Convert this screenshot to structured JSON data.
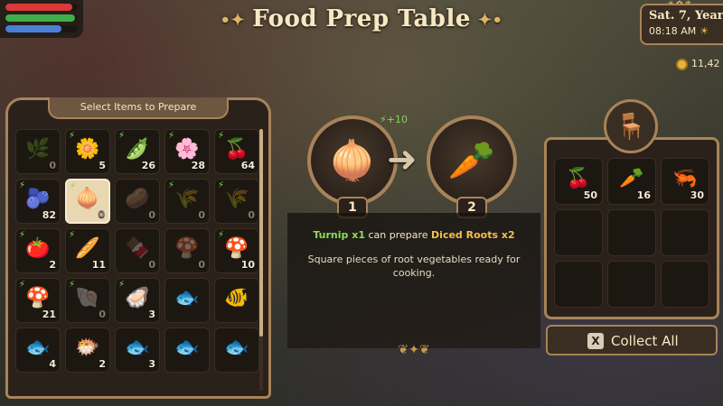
{
  "stats": {
    "health": 0.92,
    "stamina": 0.96,
    "mana": 0.78,
    "colors": {
      "health": "#d83a3a",
      "stamina": "#3fae4a",
      "mana": "#4a7fd6"
    }
  },
  "header": {
    "title": "Food Prep Table"
  },
  "datetime": {
    "date": "Sat. 7, Year",
    "time": "08:18 AM"
  },
  "currency": {
    "amount": "11,42"
  },
  "left_panel": {
    "title": "Select Items to Prepare",
    "items": [
      {
        "icon": "🌿",
        "count": "0",
        "bolt": false,
        "dim": true
      },
      {
        "icon": "🌼",
        "count": "5",
        "bolt": true
      },
      {
        "icon": "🫛",
        "count": "26",
        "bolt": true
      },
      {
        "icon": "🌸",
        "count": "28",
        "bolt": true
      },
      {
        "icon": "🍒",
        "count": "64",
        "bolt": true
      },
      {
        "icon": "🫐",
        "count": "82",
        "bolt": true
      },
      {
        "icon": "🧅",
        "count": "0",
        "bolt": true,
        "selected": true
      },
      {
        "icon": "🥔",
        "count": "0",
        "bolt": false,
        "dim": true
      },
      {
        "icon": "🌾",
        "count": "0",
        "bolt": true,
        "dim": true
      },
      {
        "icon": "🌾",
        "count": "0",
        "bolt": true,
        "dim": true
      },
      {
        "icon": "🍅",
        "count": "2",
        "bolt": true
      },
      {
        "icon": "🥖",
        "count": "11",
        "bolt": true
      },
      {
        "icon": "🍫",
        "count": "0",
        "bolt": false,
        "dim": true
      },
      {
        "icon": "🍄",
        "count": "0",
        "bolt": false,
        "dim": true
      },
      {
        "icon": "🍄",
        "count": "10",
        "bolt": true
      },
      {
        "icon": "🍄",
        "count": "21",
        "bolt": true
      },
      {
        "icon": "🐚",
        "count": "0",
        "bolt": true,
        "dim": true
      },
      {
        "icon": "🦪",
        "count": "3",
        "bolt": true
      },
      {
        "icon": "🐟",
        "count": "",
        "bolt": false
      },
      {
        "icon": "🐠",
        "count": "",
        "bolt": false
      },
      {
        "icon": "🐟",
        "count": "4",
        "bolt": false
      },
      {
        "icon": "🐡",
        "count": "2",
        "bolt": false
      },
      {
        "icon": "🐟",
        "count": "3",
        "bolt": false
      },
      {
        "icon": "🐟",
        "count": "",
        "bolt": false
      },
      {
        "icon": "🐟",
        "count": "",
        "bolt": false
      }
    ]
  },
  "recipe": {
    "input_icon": "🧅",
    "output_icon": "🥕",
    "energy_bonus": "+10",
    "input_number": "1",
    "output_number": "2",
    "ingredient": "Turnip x1",
    "middle": " can prepare ",
    "result": "Diced Roots x2",
    "description": "Square pieces of root vegetables ready for cooking."
  },
  "right_panel": {
    "table_icon": "🪑",
    "outputs": [
      {
        "icon": "🍒",
        "count": "50"
      },
      {
        "icon": "🥕",
        "count": "16"
      },
      {
        "icon": "🦐",
        "count": "30"
      },
      {
        "icon": "",
        "count": ""
      },
      {
        "icon": "",
        "count": ""
      },
      {
        "icon": "",
        "count": ""
      },
      {
        "icon": "",
        "count": ""
      },
      {
        "icon": "",
        "count": ""
      },
      {
        "icon": "",
        "count": ""
      }
    ],
    "collect_key": "X",
    "collect_label": "Collect All"
  }
}
